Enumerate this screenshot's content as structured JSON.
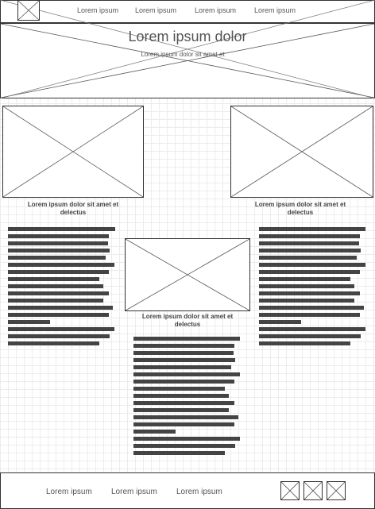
{
  "header": {
    "nav": [
      "Lorem ipsum",
      "Lorem ipsum",
      "Lorem ipsum",
      "Lorem ipsum"
    ]
  },
  "hero": {
    "title": "Lorem ipsum dolor",
    "subtitle": "Lorem ipsum dolor sit amet et"
  },
  "cards": [
    {
      "caption": "Lorem ipsum dolor sit amet et delectus"
    },
    {
      "caption": "Lorem ipsum dolor sit amet et delectus"
    },
    {
      "caption": "Lorem ipsum dolor sit amet et delectus"
    }
  ],
  "footer": {
    "links": [
      "Lorem ipsum",
      "Lorem ipsum",
      "Lorem ipsum"
    ]
  }
}
